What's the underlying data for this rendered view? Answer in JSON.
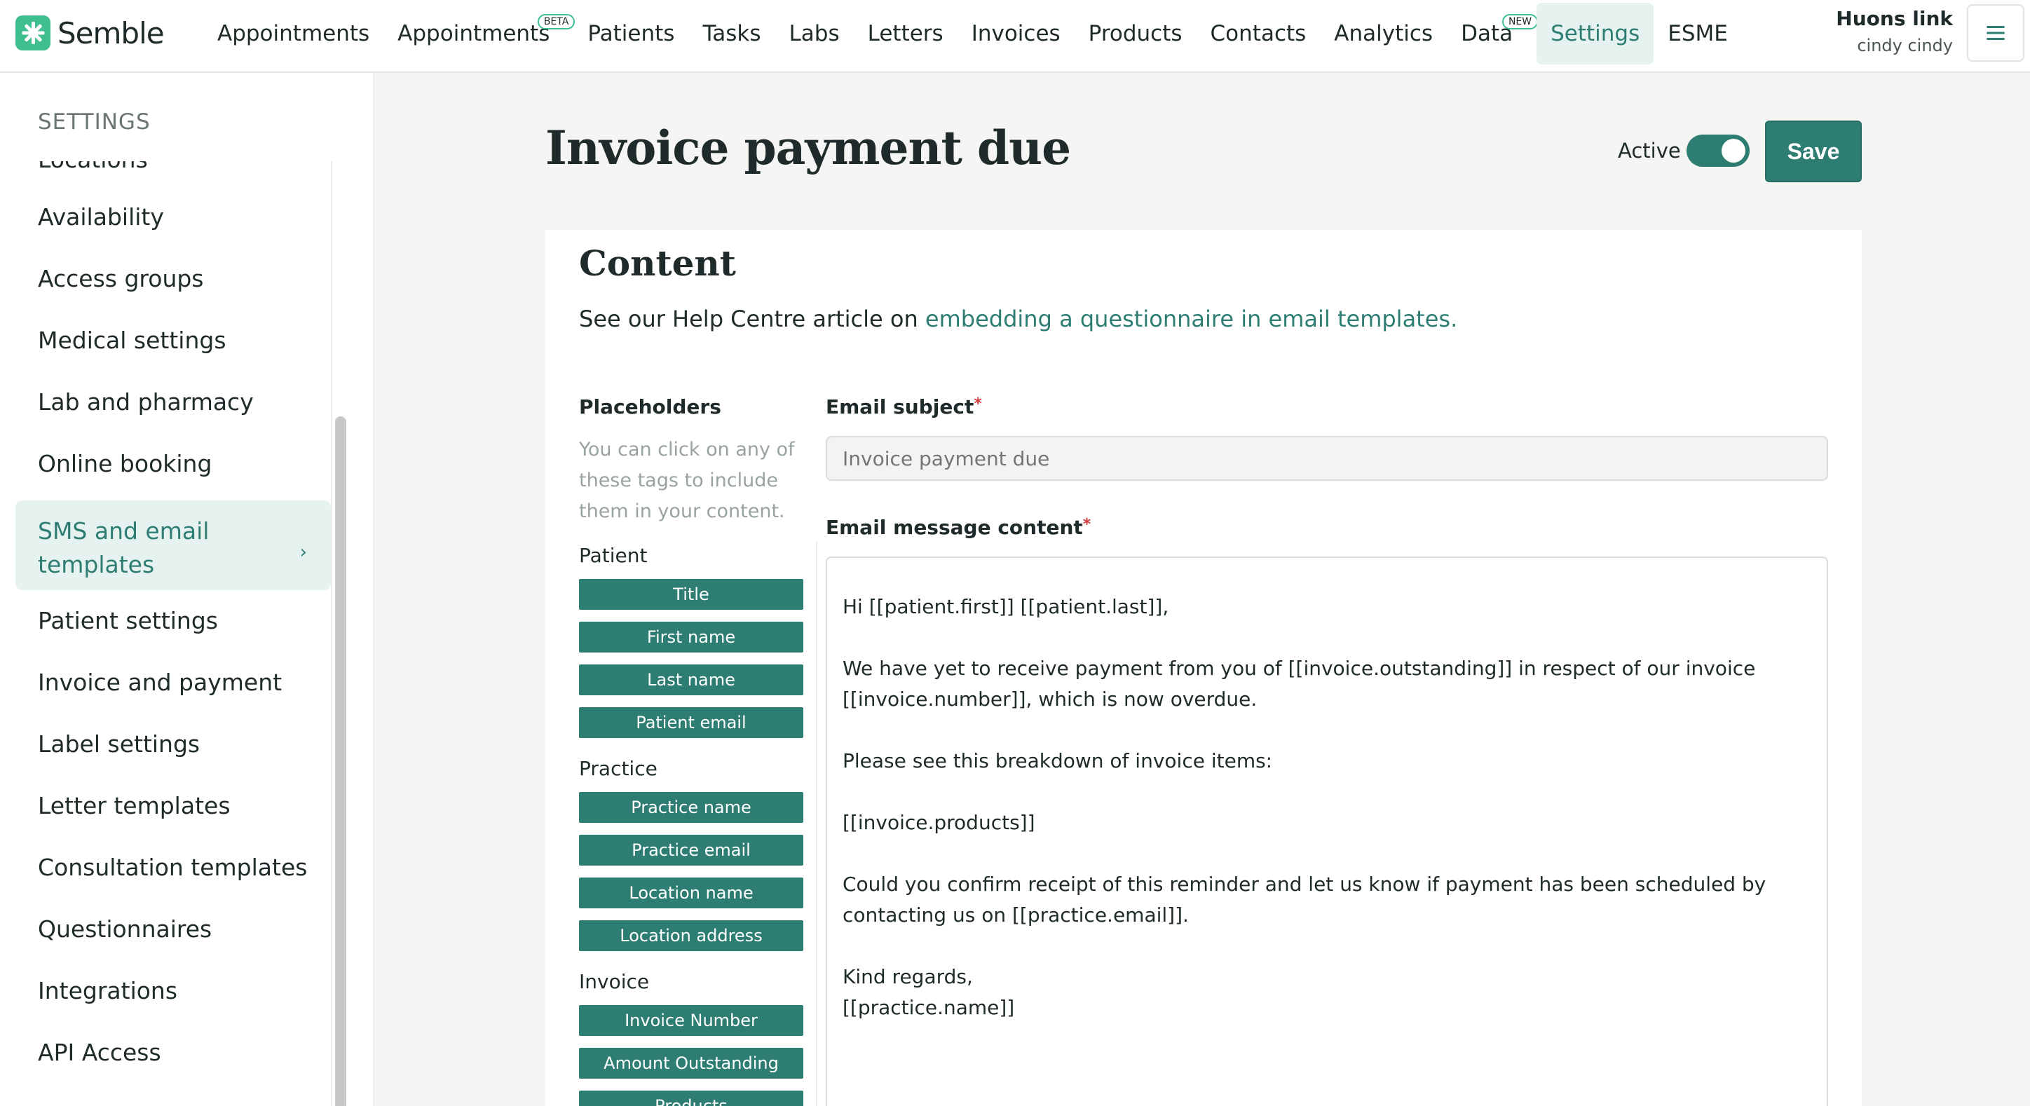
{
  "brand": {
    "name": "Semble",
    "accent": "#2d7d73",
    "logo_color": "#3fbf8f"
  },
  "nav": {
    "items": [
      {
        "label": "Appointments"
      },
      {
        "label": "Appointments",
        "badge": "BETA"
      },
      {
        "label": "Patients"
      },
      {
        "label": "Tasks"
      },
      {
        "label": "Labs"
      },
      {
        "label": "Letters"
      },
      {
        "label": "Invoices"
      },
      {
        "label": "Products"
      },
      {
        "label": "Contacts"
      },
      {
        "label": "Analytics"
      },
      {
        "label": "Data",
        "badge": "NEW"
      },
      {
        "label": "Settings",
        "active": true
      },
      {
        "label": "ESME"
      }
    ]
  },
  "user": {
    "practice": "Huons link",
    "name": "cindy cindy"
  },
  "sidebar": {
    "title": "SETTINGS",
    "items": [
      {
        "label": "Locations"
      },
      {
        "label": "Availability"
      },
      {
        "label": "Access groups"
      },
      {
        "label": "Medical settings"
      },
      {
        "label": "Lab and pharmacy"
      },
      {
        "label": "Online booking"
      },
      {
        "label": "SMS and email templates",
        "active": true
      },
      {
        "label": "Patient settings"
      },
      {
        "label": "Invoice and payment"
      },
      {
        "label": "Label settings"
      },
      {
        "label": "Letter templates"
      },
      {
        "label": "Consultation templates"
      },
      {
        "label": "Questionnaires"
      },
      {
        "label": "Integrations"
      },
      {
        "label": "API Access"
      }
    ]
  },
  "page": {
    "title": "Invoice payment due",
    "active_label": "Active",
    "active": true,
    "save_label": "Save"
  },
  "content": {
    "title": "Content",
    "help_prefix": "See our Help Centre article on ",
    "help_link": "embedding a questionnaire in email templates.",
    "placeholders": {
      "title": "Placeholders",
      "description": "You can click on any of these tags to include them in your content.",
      "groups": [
        {
          "label": "Patient",
          "tags": [
            "Title",
            "First name",
            "Last name",
            "Patient email"
          ]
        },
        {
          "label": "Practice",
          "tags": [
            "Practice name",
            "Practice email",
            "Location name",
            "Location address"
          ]
        },
        {
          "label": "Invoice",
          "tags": [
            "Invoice Number",
            "Amount Outstanding",
            "Products"
          ]
        }
      ]
    },
    "email_subject": {
      "label": "Email subject",
      "required_mark": "*",
      "placeholder": "Invoice payment due"
    },
    "email_message": {
      "label": "Email message content",
      "required_mark": "*",
      "paragraphs": [
        "Hi [[patient.first]] [[patient.last]],",
        "We have yet to receive payment from you of [[invoice.outstanding]] in respect of our invoice [[invoice.number]], which is now overdue.",
        "Please see this breakdown of invoice items:",
        "[[invoice.products]]",
        "Could you confirm receipt of this reminder and let us know if payment has been scheduled by contacting us on [[practice.email]].",
        "Kind regards,\n[[practice.name]]"
      ]
    }
  }
}
